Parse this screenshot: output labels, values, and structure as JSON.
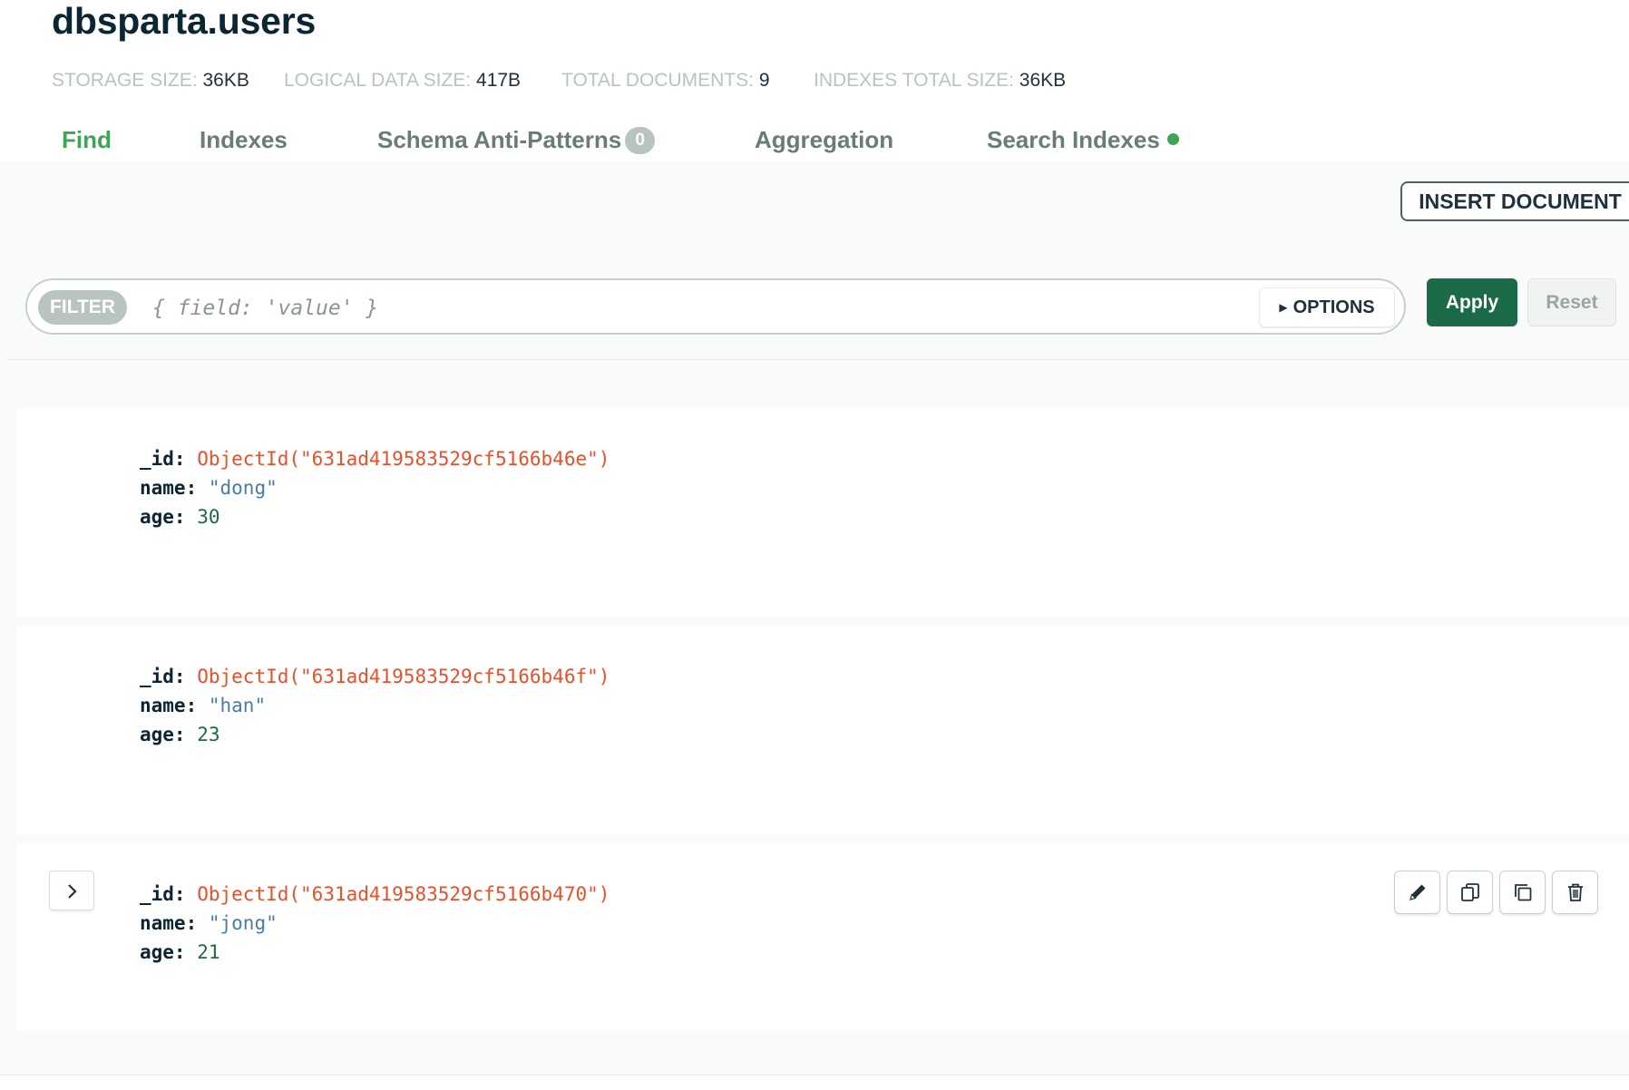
{
  "header": {
    "collection_title": "dbsparta.users"
  },
  "stats": [
    {
      "key": "STORAGE SIZE:",
      "value": "36KB"
    },
    {
      "key": "LOGICAL DATA SIZE:",
      "value": "417B"
    },
    {
      "key": "TOTAL DOCUMENTS:",
      "value": "9"
    },
    {
      "key": "INDEXES TOTAL SIZE:",
      "value": "36KB"
    }
  ],
  "tabs": [
    {
      "label": "Find",
      "active": true
    },
    {
      "label": "Indexes"
    },
    {
      "label": "Schema Anti-Patterns",
      "badge": "0"
    },
    {
      "label": "Aggregation"
    },
    {
      "label": "Search Indexes"
    }
  ],
  "toolbar": {
    "insert_label": "INSERT DOCUMENT",
    "filter_pill": "FILTER",
    "filter_placeholder": "{ field: 'value' }",
    "options_label": "OPTIONS",
    "apply_label": "Apply",
    "reset_label": "Reset"
  },
  "documents": [
    {
      "fields": [
        {
          "key": "_id:",
          "value": "ObjectId(\"631ad419583529cf5166b46e\")"
        },
        {
          "key": "name:",
          "value": "\"dong\""
        },
        {
          "key": "age:",
          "value": "30"
        }
      ]
    },
    {
      "fields": [
        {
          "key": "_id:",
          "value": "ObjectId(\"631ad419583529cf5166b46f\")"
        },
        {
          "key": "name:",
          "value": "\"han\""
        },
        {
          "key": "age:",
          "value": "23"
        }
      ]
    },
    {
      "fields": [
        {
          "key": "_id:",
          "value": "ObjectId(\"631ad419583529cf5166b470\")"
        },
        {
          "key": "name:",
          "value": "\"jong\""
        },
        {
          "key": "age:",
          "value": "21"
        }
      ]
    }
  ],
  "icons": {
    "expand": "chevron-right-icon",
    "edit": "pencil-icon",
    "copy": "copy-icon",
    "clone": "clone-icon",
    "delete": "trash-icon"
  },
  "colors": {
    "accent_green": "#3da555",
    "apply_green": "#1c6b48",
    "objectid_red": "#e8502a",
    "string_blue": "#4d79a8",
    "number_green": "#1f6b41"
  }
}
